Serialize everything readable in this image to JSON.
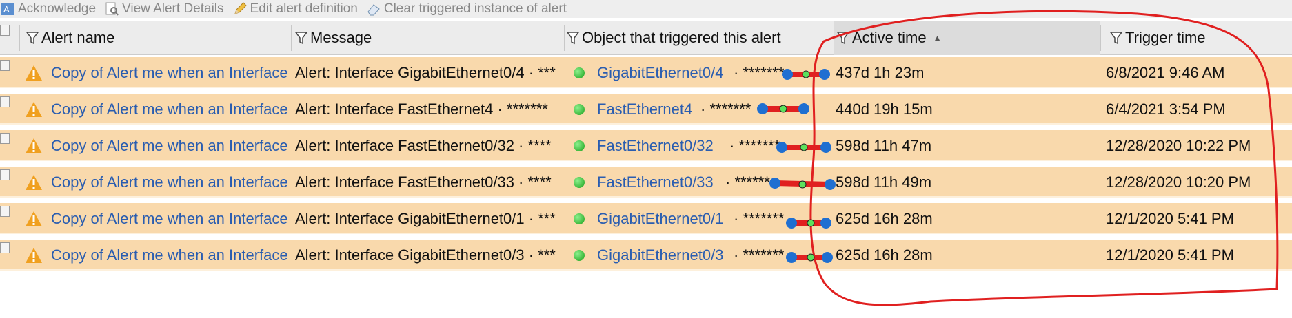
{
  "toolbar": {
    "acknowledge": "Acknowledge",
    "view_details": "View Alert Details",
    "edit_definition": "Edit alert definition",
    "clear_instance": "Clear triggered instance of alert"
  },
  "columns": {
    "alert_name": "Alert name",
    "message": "Message",
    "object": "Object that triggered this alert",
    "active_time": "Active time",
    "trigger_time": "Trigger time"
  },
  "rows": [
    {
      "alert_name": "Copy of Alert me when an Interface",
      "message": "Alert: Interface GigabitEthernet0/4 · ***",
      "object": "GigabitEthernet0/4",
      "object_suffix": "· *******",
      "active_time": "437d 1h 23m",
      "trigger_time": "6/8/2021 9:46 AM"
    },
    {
      "alert_name": "Copy of Alert me when an Interface",
      "message": "Alert: Interface FastEthernet4 · *******",
      "object": "FastEthernet4",
      "object_suffix": "· *******",
      "active_time": "440d 19h 15m",
      "trigger_time": "6/4/2021 3:54 PM"
    },
    {
      "alert_name": "Copy of Alert me when an Interface",
      "message": "Alert: Interface FastEthernet0/32 · ****",
      "object": "FastEthernet0/32",
      "object_suffix": "· *******",
      "active_time": "598d 11h 47m",
      "trigger_time": "12/28/2020 10:22 PM"
    },
    {
      "alert_name": "Copy of Alert me when an Interface",
      "message": "Alert: Interface FastEthernet0/33 · ****",
      "object": "FastEthernet0/33",
      "object_suffix": "· ******",
      "active_time": "598d 11h 49m",
      "trigger_time": "12/28/2020 10:20 PM"
    },
    {
      "alert_name": "Copy of Alert me when an Interface",
      "message": "Alert: Interface GigabitEthernet0/1 · ***",
      "object": "GigabitEthernet0/1",
      "object_suffix": "· *******",
      "active_time": "625d 16h 28m",
      "trigger_time": "12/1/2020 5:41 PM"
    },
    {
      "alert_name": "Copy of Alert me when an Interface",
      "message": "Alert: Interface GigabitEthernet0/3 · ***",
      "object": "GigabitEthernet0/3",
      "object_suffix": "· *******",
      "active_time": "625d 16h 28m",
      "trigger_time": "12/1/2020 5:41 PM"
    }
  ],
  "colors": {
    "row_bg": "#f9d9ac",
    "link": "#2a5db0",
    "warning": "#f0a020",
    "status_up": "#1aa01a",
    "annotation_red": "#e02020",
    "handle_blue": "#1f6fd1"
  },
  "icons": {
    "acknowledge": "acknowledge-icon",
    "view_details": "view-details-icon",
    "edit_definition": "pencil-icon",
    "clear_instance": "eraser-icon",
    "filter": "funnel-icon",
    "warning": "warning-triangle-icon",
    "status": "status-up-icon"
  }
}
